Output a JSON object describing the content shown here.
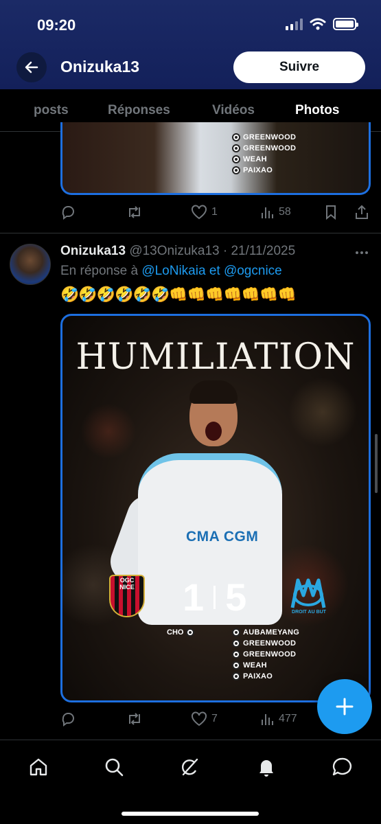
{
  "status_bar": {
    "time": "09:20"
  },
  "header": {
    "title": "Onizuka13",
    "follow_label": "Suivre"
  },
  "tabs": [
    {
      "label": "posts",
      "active": false
    },
    {
      "label": "Réponses",
      "active": false
    },
    {
      "label": "Vidéos",
      "active": false
    },
    {
      "label": "Photos",
      "active": true
    }
  ],
  "previous_post": {
    "scorers": [
      "GREENWOOD",
      "GREENWOOD",
      "WEAH",
      "PAIXAO"
    ],
    "actions": {
      "replies": "",
      "reposts": "",
      "likes": "1",
      "views": "58"
    }
  },
  "post": {
    "author_name": "Onizuka13",
    "handle": "@13Onizuka13",
    "date": "21/11/2025",
    "reply_prefix": "En réponse à",
    "mention_1": "@LoNikaia",
    "reply_and": "et",
    "mention_2": "@ogcnice",
    "emoji_text": "🤣🤣🤣🤣🤣🤣👊👊👊👊👊👊👊",
    "media": {
      "headline": "HUMILIATION",
      "sponsor": "CMA CGM",
      "home_team_crest_text": "OGC NICE",
      "home_score": "1",
      "away_score": "5",
      "away_team_motto": "DROIT AU BUT",
      "home_scorer": "CHO",
      "away_scorers": [
        "AUBAMEYANG",
        "GREENWOOD",
        "GREENWOOD",
        "WEAH",
        "PAIXAO"
      ]
    },
    "actions": {
      "replies": "",
      "reposts": "",
      "likes": "7",
      "views": "477"
    }
  },
  "colors": {
    "accent": "#1d9bf0",
    "header_bg": "#1b2a66",
    "background": "#000000",
    "muted": "#71767b"
  },
  "icons": {
    "back": "arrow-left-icon",
    "fab": "plus-icon",
    "nav": [
      "home-icon",
      "search-icon",
      "grok-icon",
      "bell-icon",
      "messages-icon"
    ]
  }
}
